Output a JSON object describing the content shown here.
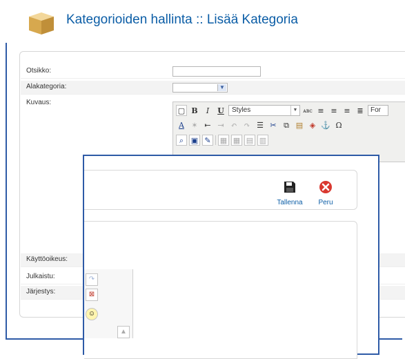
{
  "header": {
    "title": "Kategorioiden hallinta :: Lisää Kategoria"
  },
  "form": {
    "fields": [
      {
        "label": "Otsikko:"
      },
      {
        "label": "Alakategoria:"
      },
      {
        "label": "Kuvaus:"
      },
      {
        "label": "Käyttöoikeus:"
      },
      {
        "label": "Julkaistu:"
      },
      {
        "label": "Järjestys:"
      }
    ],
    "title_value": "",
    "parent_selected": ""
  },
  "editor": {
    "styles_label": "Styles",
    "font_label": "For"
  },
  "popup": {
    "save_label": "Tallenna",
    "cancel_label": "Peru"
  },
  "colors": {
    "accent": "#0b5da6",
    "frame": "#2d5aa6"
  }
}
